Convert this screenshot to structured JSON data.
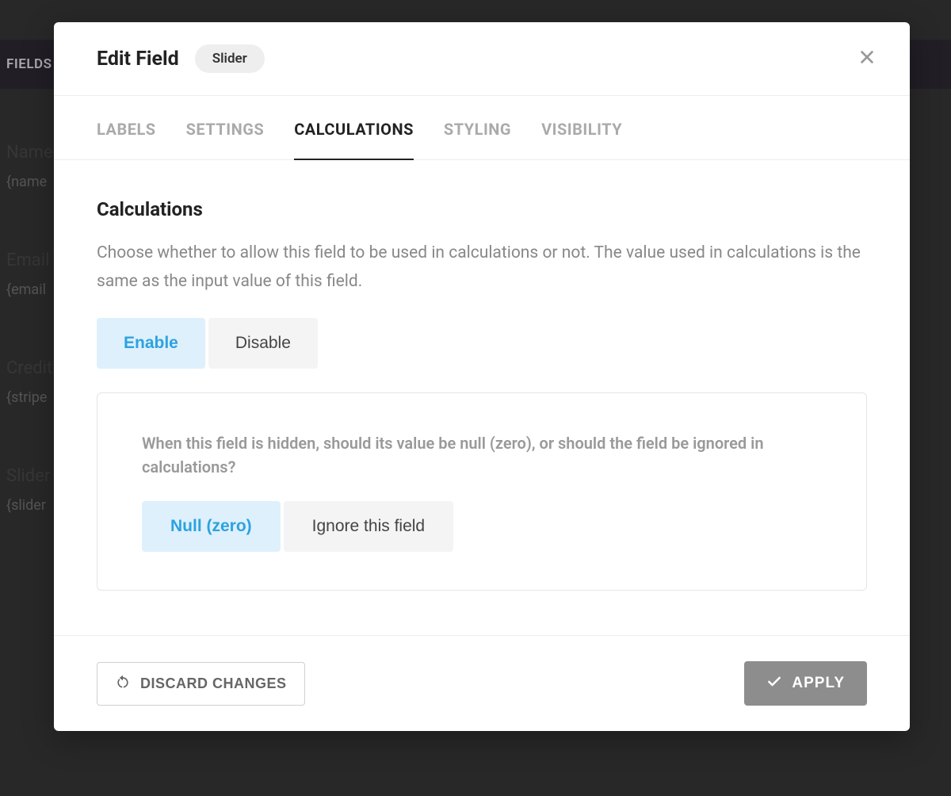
{
  "background": {
    "tab_label": "FIELDS",
    "fields": [
      {
        "name": "Name",
        "tag": "{name"
      },
      {
        "name": "Email",
        "tag": "{email"
      },
      {
        "name": "Credit",
        "tag": "{stripe"
      },
      {
        "name": "Slider",
        "tag": "{slider"
      }
    ]
  },
  "modal": {
    "title": "Edit Field",
    "badge": "Slider",
    "tabs": {
      "labels": "LABELS",
      "settings": "SETTINGS",
      "calculations": "CALCULATIONS",
      "styling": "STYLING",
      "visibility": "VISIBILITY"
    },
    "section": {
      "title": "Calculations",
      "description": "Choose whether to allow this field to be used in calculations or not. The value used in calculations is the same as the input value of this field.",
      "toggle": {
        "enable": "Enable",
        "disable": "Disable"
      },
      "sub_panel": {
        "question": "When this field is hidden, should its value be null (zero), or should the field be ignored in calculations?",
        "options": {
          "null_zero": "Null (zero)",
          "ignore": "Ignore this field"
        }
      }
    },
    "footer": {
      "discard": "DISCARD CHANGES",
      "apply": "APPLY"
    }
  }
}
